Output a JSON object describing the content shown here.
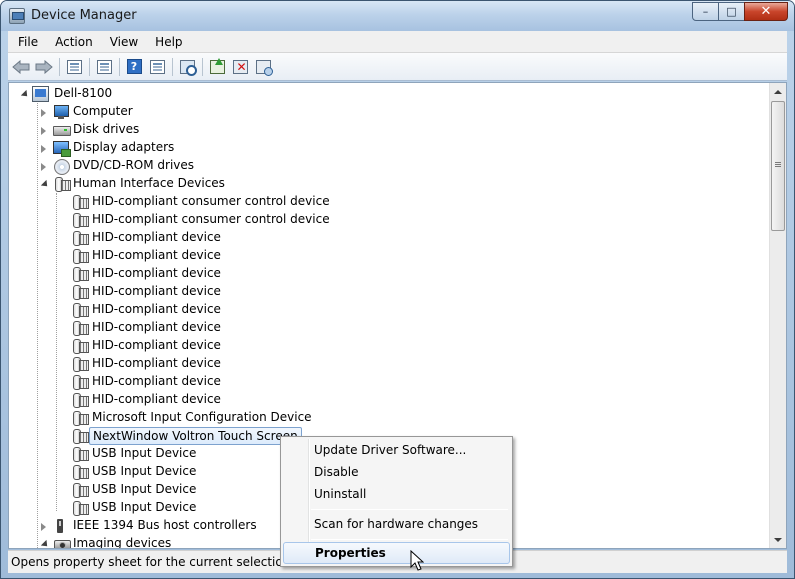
{
  "window": {
    "title": "Device Manager",
    "caption": {
      "minimize": "–",
      "maximize": "□",
      "close": "✕"
    }
  },
  "menu": [
    "File",
    "Action",
    "View",
    "Help"
  ],
  "toolbar": {
    "icons": [
      "back-arrow-icon",
      "forward-arrow-icon",
      "show-hide-tree-icon",
      "properties-icon",
      "help-icon",
      "view-icon",
      "scan-hardware-icon",
      "update-driver-icon",
      "uninstall-icon",
      "add-legacy-hardware-icon"
    ]
  },
  "tree": {
    "root": "Dell-8100",
    "categories": [
      {
        "label": "Computer",
        "icon": "computer-icon",
        "state": "collapsed"
      },
      {
        "label": "Disk drives",
        "icon": "disk-drive-icon",
        "state": "collapsed"
      },
      {
        "label": "Display adapters",
        "icon": "display-adapter-icon",
        "state": "collapsed"
      },
      {
        "label": "DVD/CD-ROM drives",
        "icon": "dvd-drive-icon",
        "state": "collapsed"
      },
      {
        "label": "Human Interface Devices",
        "icon": "hid-icon",
        "state": "expanded"
      }
    ],
    "hid_children": [
      "HID-compliant consumer control device",
      "HID-compliant consumer control device",
      "HID-compliant device",
      "HID-compliant device",
      "HID-compliant device",
      "HID-compliant device",
      "HID-compliant device",
      "HID-compliant device",
      "HID-compliant device",
      "HID-compliant device",
      "HID-compliant device",
      "HID-compliant device",
      "Microsoft Input Configuration Device",
      "NextWindow Voltron Touch Screen",
      "USB Input Device",
      "USB Input Device",
      "USB Input Device",
      "USB Input Device"
    ],
    "selected": "NextWindow Voltron Touch Screen",
    "after": [
      {
        "label": "IEEE 1394 Bus host controllers",
        "icon": "ieee1394-icon",
        "state": "collapsed"
      },
      {
        "label": "Imaging devices",
        "icon": "imaging-device-icon",
        "state": "collapsed"
      }
    ]
  },
  "context_menu": {
    "update": "Update Driver Software...",
    "disable": "Disable",
    "uninstall": "Uninstall",
    "scan": "Scan for hardware changes",
    "properties": "Properties"
  },
  "status": "Opens property sheet for the current selection."
}
